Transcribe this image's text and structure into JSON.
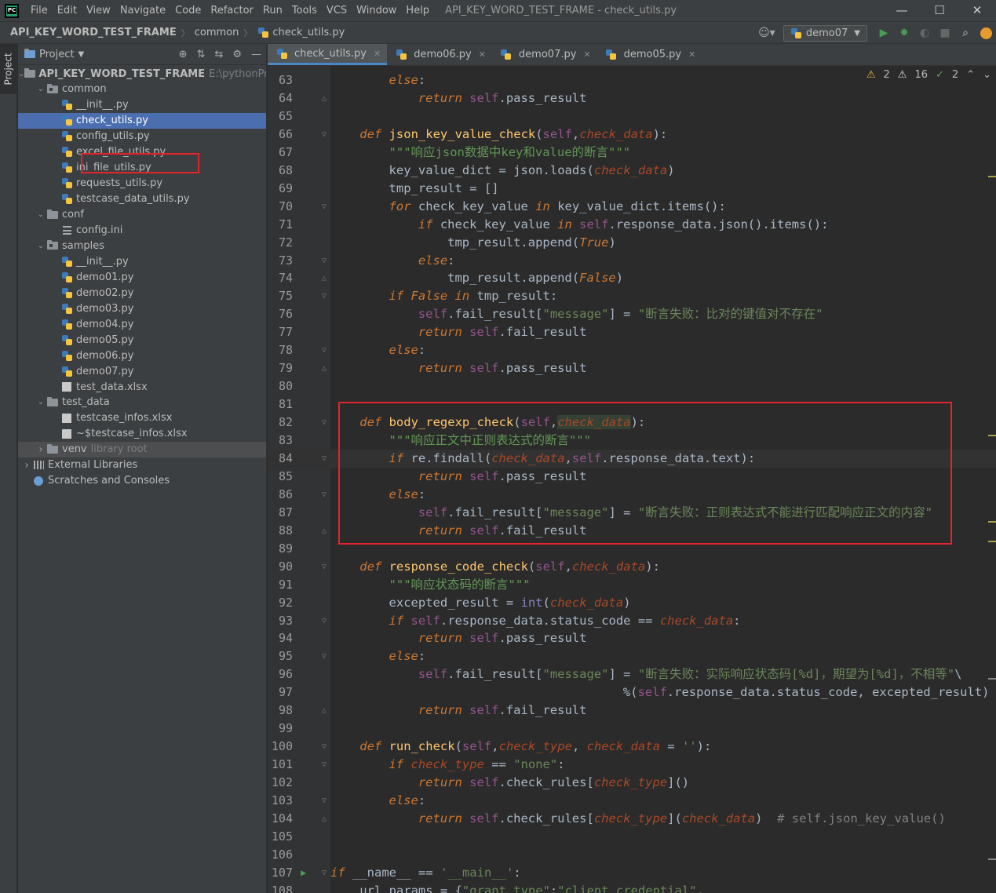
{
  "menubar": {
    "items": [
      "File",
      "Edit",
      "View",
      "Navigate",
      "Code",
      "Refactor",
      "Run",
      "Tools",
      "VCS",
      "Window",
      "Help"
    ],
    "window_title": "API_KEY_WORD_TEST_FRAME - check_utils.py",
    "logo_text": "PC"
  },
  "navbar": {
    "breadcrumbs": [
      "API_KEY_WORD_TEST_FRAME",
      "common",
      "check_utils.py"
    ],
    "run_config": "demo07"
  },
  "sidebar": {
    "project_tab": "Project"
  },
  "project_panel": {
    "title": "Project",
    "tree": [
      {
        "label": "API_KEY_WORD_TEST_FRAME",
        "hint": "E:\\pythonProjec",
        "type": "folder",
        "depth": 0,
        "expanded": true,
        "bold": true
      },
      {
        "label": "common",
        "type": "package",
        "depth": 1,
        "expanded": true
      },
      {
        "label": "__init__.py",
        "type": "py",
        "depth": 2
      },
      {
        "label": "check_utils.py",
        "type": "py",
        "depth": 2,
        "selected": true
      },
      {
        "label": "config_utils.py",
        "type": "py",
        "depth": 2
      },
      {
        "label": "excel_file_utils.py",
        "type": "py",
        "depth": 2
      },
      {
        "label": "ini_file_utils.py",
        "type": "py",
        "depth": 2
      },
      {
        "label": "requests_utils.py",
        "type": "py",
        "depth": 2
      },
      {
        "label": "testcase_data_utils.py",
        "type": "py",
        "depth": 2
      },
      {
        "label": "conf",
        "type": "folder",
        "depth": 1,
        "expanded": true
      },
      {
        "label": "config.ini",
        "type": "ini",
        "depth": 2
      },
      {
        "label": "samples",
        "type": "package",
        "depth": 1,
        "expanded": true
      },
      {
        "label": "__init__.py",
        "type": "py",
        "depth": 2
      },
      {
        "label": "demo01.py",
        "type": "py",
        "depth": 2
      },
      {
        "label": "demo02.py",
        "type": "py",
        "depth": 2
      },
      {
        "label": "demo03.py",
        "type": "py",
        "depth": 2
      },
      {
        "label": "demo04.py",
        "type": "py",
        "depth": 2
      },
      {
        "label": "demo05.py",
        "type": "py",
        "depth": 2
      },
      {
        "label": "demo06.py",
        "type": "py",
        "depth": 2
      },
      {
        "label": "demo07.py",
        "type": "py",
        "depth": 2
      },
      {
        "label": "test_data.xlsx",
        "type": "xls",
        "depth": 2
      },
      {
        "label": "test_data",
        "type": "folder",
        "depth": 1,
        "expanded": true
      },
      {
        "label": "testcase_infos.xlsx",
        "type": "xls",
        "depth": 2
      },
      {
        "label": "~$testcase_infos.xlsx",
        "type": "xls",
        "depth": 2
      },
      {
        "label": "venv",
        "hint": "library root",
        "type": "folder",
        "depth": 1,
        "expanded": false,
        "venv": true
      },
      {
        "label": "External Libraries",
        "type": "lib",
        "depth": 0,
        "expanded": false
      },
      {
        "label": "Scratches and Consoles",
        "type": "scratch",
        "depth": 0
      }
    ]
  },
  "editor": {
    "tabs": [
      {
        "label": "check_utils.py",
        "active": true
      },
      {
        "label": "demo06.py"
      },
      {
        "label": "demo07.py"
      },
      {
        "label": "demo05.py"
      }
    ],
    "inspections": {
      "warnings": "2",
      "weak_warnings": "16",
      "typos": "2"
    },
    "current_line": 84,
    "lines": [
      {
        "n": 63,
        "ind": 8,
        "t": [
          [
            "ki",
            "else"
          ],
          [
            "pl",
            ":"
          ]
        ]
      },
      {
        "n": 64,
        "ind": 12,
        "t": [
          [
            "ki",
            "return "
          ],
          [
            "sf",
            "self"
          ],
          [
            "pl",
            ".pass_result"
          ]
        ]
      },
      {
        "n": 65,
        "ind": 0,
        "t": []
      },
      {
        "n": 66,
        "ind": 4,
        "t": [
          [
            "ki",
            "def "
          ],
          [
            "fn",
            "json_key_value_check"
          ],
          [
            "pl",
            "("
          ],
          [
            "sf",
            "self"
          ],
          [
            "pl",
            ","
          ],
          [
            "pr",
            "check_data"
          ],
          [
            "pl",
            "):"
          ]
        ]
      },
      {
        "n": 67,
        "ind": 8,
        "t": [
          [
            "ds",
            "\"\"\"响应json数据中key和value的断言\"\"\""
          ]
        ]
      },
      {
        "n": 68,
        "ind": 8,
        "t": [
          [
            "pl",
            "key_value_dict = json."
          ],
          [
            "call",
            "loads"
          ],
          [
            "pl",
            "("
          ],
          [
            "pr",
            "check_data"
          ],
          [
            "pl",
            ")"
          ]
        ]
      },
      {
        "n": 69,
        "ind": 8,
        "t": [
          [
            "pl",
            "tmp_result = []"
          ]
        ]
      },
      {
        "n": 70,
        "ind": 8,
        "t": [
          [
            "ki",
            "for "
          ],
          [
            "pl",
            "check_key_value "
          ],
          [
            "ki",
            "in "
          ],
          [
            "pl",
            "key_value_dict."
          ],
          [
            "call",
            "items"
          ],
          [
            "pl",
            "():"
          ]
        ]
      },
      {
        "n": 71,
        "ind": 12,
        "t": [
          [
            "ki",
            "if "
          ],
          [
            "pl",
            "check_key_value "
          ],
          [
            "ki",
            "in "
          ],
          [
            "sf",
            "self"
          ],
          [
            "pl",
            ".response_data."
          ],
          [
            "call",
            "json"
          ],
          [
            "pl",
            "()."
          ],
          [
            "call",
            "items"
          ],
          [
            "pl",
            "():"
          ]
        ]
      },
      {
        "n": 72,
        "ind": 16,
        "t": [
          [
            "pl",
            "tmp_result."
          ],
          [
            "call",
            "append"
          ],
          [
            "pl",
            "("
          ],
          [
            "ki",
            "True"
          ],
          [
            "pl",
            ")"
          ]
        ]
      },
      {
        "n": 73,
        "ind": 12,
        "t": [
          [
            "ki",
            "else"
          ],
          [
            "pl",
            ":"
          ]
        ]
      },
      {
        "n": 74,
        "ind": 16,
        "t": [
          [
            "pl",
            "tmp_result."
          ],
          [
            "call",
            "append"
          ],
          [
            "pl",
            "("
          ],
          [
            "ki",
            "False"
          ],
          [
            "pl",
            ")"
          ]
        ]
      },
      {
        "n": 75,
        "ind": 8,
        "t": [
          [
            "ki",
            "if "
          ],
          [
            "ki",
            "False "
          ],
          [
            "ki",
            "in "
          ],
          [
            "pl",
            "tmp_result:"
          ]
        ]
      },
      {
        "n": 76,
        "ind": 12,
        "t": [
          [
            "sf",
            "self"
          ],
          [
            "pl",
            ".fail_result["
          ],
          [
            "s",
            "\"message\""
          ],
          [
            "pl",
            "] = "
          ],
          [
            "s",
            "\"断言失败：比对的键值对不存在\""
          ]
        ]
      },
      {
        "n": 77,
        "ind": 12,
        "t": [
          [
            "ki",
            "return "
          ],
          [
            "sf",
            "self"
          ],
          [
            "pl",
            ".fail_result"
          ]
        ]
      },
      {
        "n": 78,
        "ind": 8,
        "t": [
          [
            "ki",
            "else"
          ],
          [
            "pl",
            ":"
          ]
        ]
      },
      {
        "n": 79,
        "ind": 12,
        "t": [
          [
            "ki",
            "return "
          ],
          [
            "sf",
            "self"
          ],
          [
            "pl",
            ".pass_result"
          ]
        ]
      },
      {
        "n": 80,
        "ind": 0,
        "t": []
      },
      {
        "n": 81,
        "ind": 0,
        "t": []
      },
      {
        "n": 82,
        "ind": 4,
        "t": [
          [
            "ki",
            "def "
          ],
          [
            "fn",
            "body_regexp_check"
          ],
          [
            "pl",
            "("
          ],
          [
            "sf",
            "self"
          ],
          [
            "pl",
            ","
          ],
          [
            "prh",
            "check_data"
          ],
          [
            "pl",
            "):"
          ]
        ]
      },
      {
        "n": 83,
        "ind": 8,
        "t": [
          [
            "ds",
            "\"\"\"响应正文中正则表达式的断言\"\"\""
          ]
        ]
      },
      {
        "n": 84,
        "ind": 8,
        "t": [
          [
            "ki",
            "if "
          ],
          [
            "pl",
            "re."
          ],
          [
            "call",
            "findall"
          ],
          [
            "pl",
            "("
          ],
          [
            "pr",
            "check_data"
          ],
          [
            "pl",
            ","
          ],
          [
            "sf",
            "self"
          ],
          [
            "pl",
            ".response_data.text):"
          ]
        ]
      },
      {
        "n": 85,
        "ind": 12,
        "t": [
          [
            "ki",
            "return "
          ],
          [
            "sf",
            "self"
          ],
          [
            "pl",
            ".pass_result"
          ]
        ]
      },
      {
        "n": 86,
        "ind": 8,
        "t": [
          [
            "ki",
            "else"
          ],
          [
            "pl",
            ":"
          ]
        ]
      },
      {
        "n": 87,
        "ind": 12,
        "t": [
          [
            "sf",
            "self"
          ],
          [
            "pl",
            ".fail_result["
          ],
          [
            "s",
            "\"message\""
          ],
          [
            "pl",
            "] = "
          ],
          [
            "s",
            "\"断言失败：正则表达式不能进行匹配响应正文的内容\""
          ]
        ]
      },
      {
        "n": 88,
        "ind": 12,
        "t": [
          [
            "ki",
            "return "
          ],
          [
            "sf",
            "self"
          ],
          [
            "pl",
            ".fail_result"
          ]
        ]
      },
      {
        "n": 89,
        "ind": 0,
        "t": []
      },
      {
        "n": 90,
        "ind": 4,
        "t": [
          [
            "ki",
            "def "
          ],
          [
            "fn",
            "response_code_check"
          ],
          [
            "pl",
            "("
          ],
          [
            "sf",
            "self"
          ],
          [
            "pl",
            ","
          ],
          [
            "pr",
            "check_data"
          ],
          [
            "pl",
            "):"
          ]
        ]
      },
      {
        "n": 91,
        "ind": 8,
        "t": [
          [
            "ds",
            "\"\"\"响应状态码的断言\"\"\""
          ]
        ]
      },
      {
        "n": 92,
        "ind": 8,
        "t": [
          [
            "pl",
            "excepted_result = "
          ],
          [
            "bi",
            "int"
          ],
          [
            "pl",
            "("
          ],
          [
            "pr",
            "check_data"
          ],
          [
            "pl",
            ")"
          ]
        ]
      },
      {
        "n": 93,
        "ind": 8,
        "t": [
          [
            "ki",
            "if "
          ],
          [
            "sf",
            "self"
          ],
          [
            "pl",
            ".response_data.status_code == "
          ],
          [
            "pr",
            "check_data"
          ],
          [
            "pl",
            ":"
          ]
        ]
      },
      {
        "n": 94,
        "ind": 12,
        "t": [
          [
            "ki",
            "return "
          ],
          [
            "sf",
            "self"
          ],
          [
            "pl",
            ".pass_result"
          ]
        ]
      },
      {
        "n": 95,
        "ind": 8,
        "t": [
          [
            "ki",
            "else"
          ],
          [
            "pl",
            ":"
          ]
        ]
      },
      {
        "n": 96,
        "ind": 12,
        "t": [
          [
            "sf",
            "self"
          ],
          [
            "pl",
            ".fail_result["
          ],
          [
            "s",
            "\"message\""
          ],
          [
            "pl",
            "] = "
          ],
          [
            "s",
            "\"断言失败：实际响应状态码[%d]，期望为[%d]，不相等\""
          ],
          [
            "pl",
            "\\"
          ]
        ]
      },
      {
        "n": 97,
        "ind": 40,
        "t": [
          [
            "pl",
            "%("
          ],
          [
            "sf",
            "self"
          ],
          [
            "pl",
            ".response_data.status_code, excepted_result)"
          ]
        ]
      },
      {
        "n": 98,
        "ind": 12,
        "t": [
          [
            "ki",
            "return "
          ],
          [
            "sf",
            "self"
          ],
          [
            "pl",
            ".fail_result"
          ]
        ]
      },
      {
        "n": 99,
        "ind": 0,
        "t": []
      },
      {
        "n": 100,
        "ind": 4,
        "t": [
          [
            "ki",
            "def "
          ],
          [
            "fn",
            "run_check"
          ],
          [
            "pl",
            "("
          ],
          [
            "sf",
            "self"
          ],
          [
            "pl",
            ","
          ],
          [
            "pr",
            "check_type"
          ],
          [
            "pl",
            ", "
          ],
          [
            "pr",
            "check_data"
          ],
          [
            "pl",
            " = "
          ],
          [
            "s",
            "''"
          ],
          [
            "pl",
            "):"
          ]
        ]
      },
      {
        "n": 101,
        "ind": 8,
        "t": [
          [
            "ki",
            "if "
          ],
          [
            "pr",
            "check_type"
          ],
          [
            "pl",
            " == "
          ],
          [
            "s",
            "\"none\""
          ],
          [
            "pl",
            ":"
          ]
        ]
      },
      {
        "n": 102,
        "ind": 12,
        "t": [
          [
            "ki",
            "return "
          ],
          [
            "sf",
            "self"
          ],
          [
            "pl",
            ".check_rules["
          ],
          [
            "pr",
            "check_type"
          ],
          [
            "pl",
            "]()"
          ]
        ]
      },
      {
        "n": 103,
        "ind": 8,
        "t": [
          [
            "ki",
            "else"
          ],
          [
            "pl",
            ":"
          ]
        ]
      },
      {
        "n": 104,
        "ind": 12,
        "t": [
          [
            "ki",
            "return "
          ],
          [
            "sf",
            "self"
          ],
          [
            "pl",
            ".check_rules["
          ],
          [
            "pr",
            "check_type"
          ],
          [
            "pl",
            "]("
          ],
          [
            "pr",
            "check_data"
          ],
          [
            "pl",
            ")  "
          ],
          [
            "cm",
            "# self.json_key_value()"
          ]
        ]
      },
      {
        "n": 105,
        "ind": 0,
        "t": []
      },
      {
        "n": 106,
        "ind": 0,
        "t": []
      },
      {
        "n": 107,
        "ind": 0,
        "t": [
          [
            "ki",
            "if "
          ],
          [
            "pl",
            "__name__ == "
          ],
          [
            "s",
            "'__main__'"
          ],
          [
            "pl",
            ":"
          ]
        ]
      },
      {
        "n": 108,
        "ind": 4,
        "t": [
          [
            "pl",
            "url_params = {"
          ],
          [
            "s",
            "\"grant_type\""
          ],
          [
            "pl",
            ":"
          ],
          [
            "s",
            "\"client_credential\""
          ],
          [
            "pl",
            ","
          ]
        ]
      }
    ]
  }
}
